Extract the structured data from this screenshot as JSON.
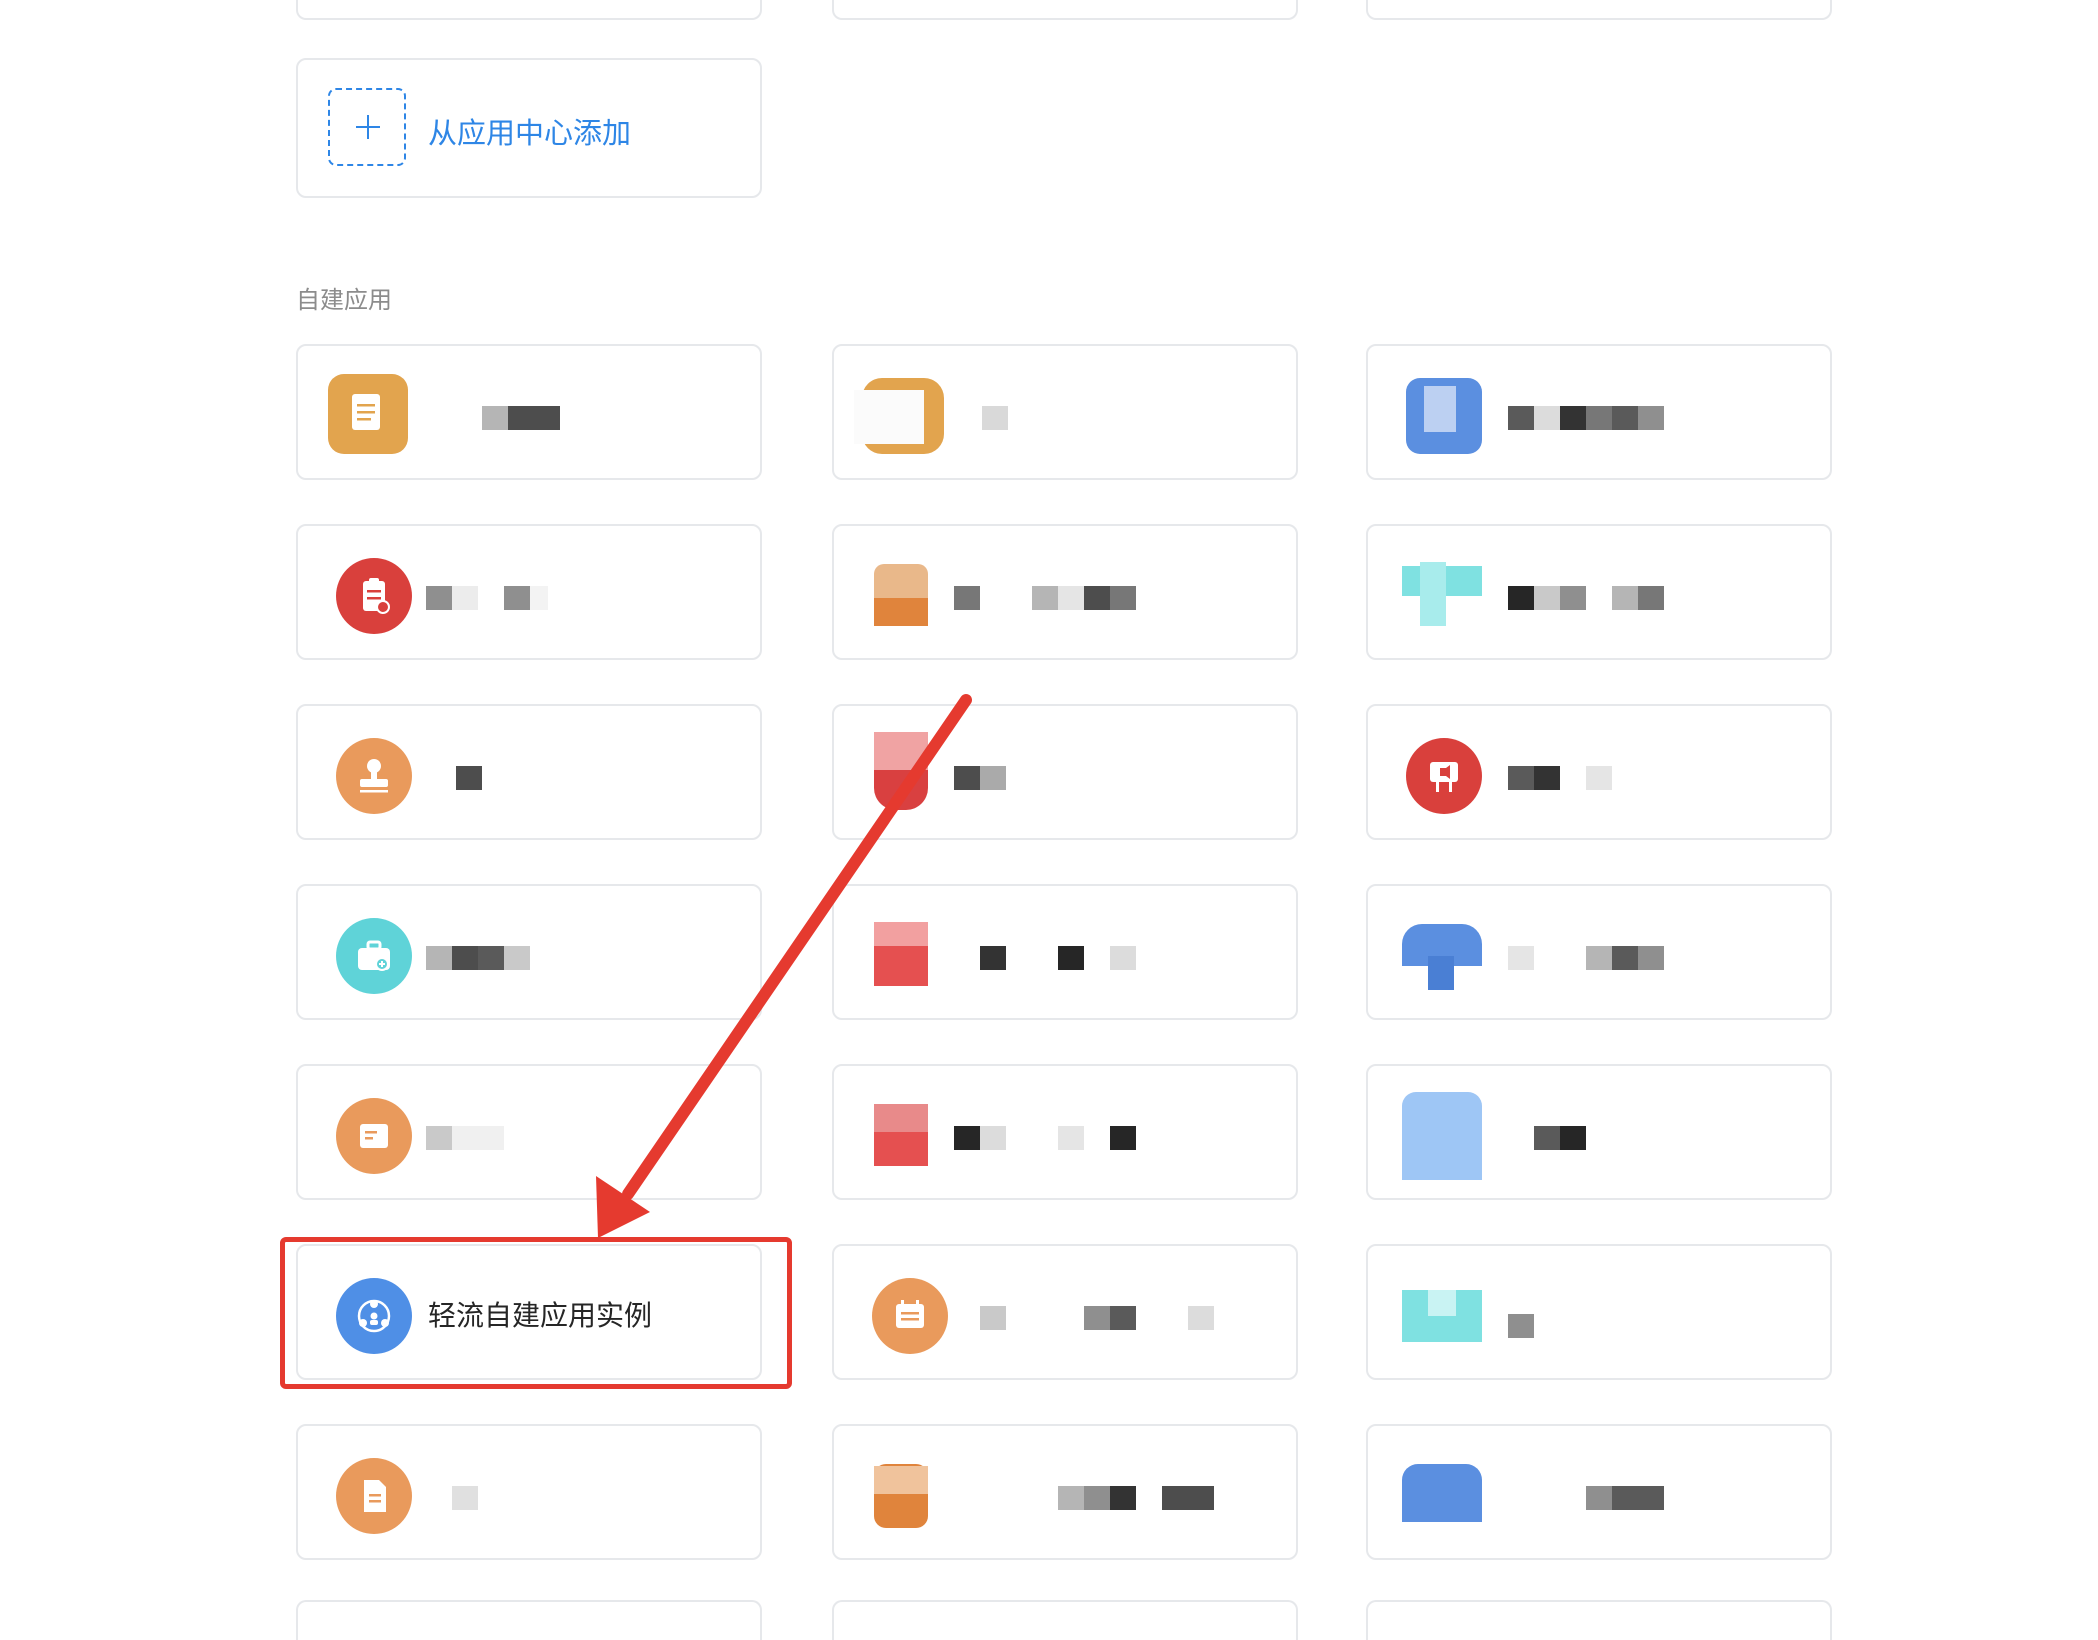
{
  "add_card": {
    "label": "从应用中心添加"
  },
  "section": {
    "title": "自建应用"
  },
  "highlighted_app": {
    "label": "轻流自建应用实例",
    "icon": "share-network-icon"
  },
  "annotation": {
    "arrow_color": "#e53a2f",
    "box_color": "#e53a2f"
  },
  "colors": {
    "accent": "#2e86e6",
    "card_border": "#e6e8eb"
  }
}
